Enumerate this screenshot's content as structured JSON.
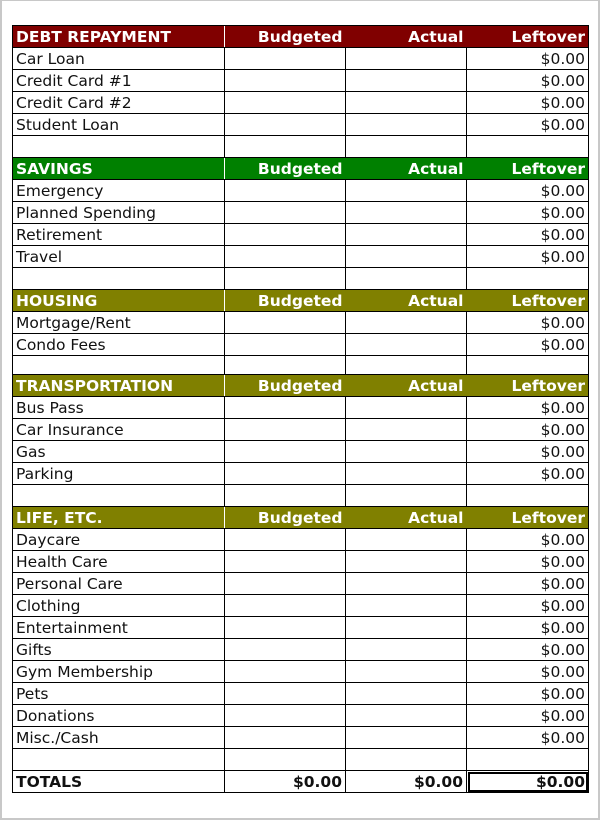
{
  "columns": [
    "Budgeted",
    "Actual",
    "Leftover"
  ],
  "colors": {
    "debt": "#800000",
    "savings": "#008000",
    "housing": "#808000",
    "transportation": "#808000",
    "life": "#808000"
  },
  "sections": [
    {
      "title": "DEBT REPAYMENT",
      "items": [
        {
          "label": "Car Loan",
          "budgeted": "",
          "actual": "",
          "leftover": "$0.00"
        },
        {
          "label": "Credit Card #1",
          "budgeted": "",
          "actual": "",
          "leftover": "$0.00"
        },
        {
          "label": "Credit Card #2",
          "budgeted": "",
          "actual": "",
          "leftover": "$0.00"
        },
        {
          "label": "Student Loan",
          "budgeted": "",
          "actual": "",
          "leftover": "$0.00"
        }
      ]
    },
    {
      "title": "SAVINGS",
      "items": [
        {
          "label": "Emergency",
          "budgeted": "",
          "actual": "",
          "leftover": "$0.00"
        },
        {
          "label": "Planned Spending",
          "budgeted": "",
          "actual": "",
          "leftover": "$0.00"
        },
        {
          "label": "Retirement",
          "budgeted": "",
          "actual": "",
          "leftover": "$0.00"
        },
        {
          "label": "Travel",
          "budgeted": "",
          "actual": "",
          "leftover": "$0.00"
        }
      ]
    },
    {
      "title": "HOUSING",
      "items": [
        {
          "label": "Mortgage/Rent",
          "budgeted": "",
          "actual": "",
          "leftover": "$0.00"
        },
        {
          "label": "Condo Fees",
          "budgeted": "",
          "actual": "",
          "leftover": "$0.00"
        }
      ]
    },
    {
      "title": "TRANSPORTATION",
      "items": [
        {
          "label": "Bus Pass",
          "budgeted": "",
          "actual": "",
          "leftover": "$0.00"
        },
        {
          "label": "Car Insurance",
          "budgeted": "",
          "actual": "",
          "leftover": "$0.00"
        },
        {
          "label": "Gas",
          "budgeted": "",
          "actual": "",
          "leftover": "$0.00"
        },
        {
          "label": "Parking",
          "budgeted": "",
          "actual": "",
          "leftover": "$0.00"
        }
      ]
    },
    {
      "title": "LIFE, ETC.",
      "items": [
        {
          "label": "Daycare",
          "budgeted": "",
          "actual": "",
          "leftover": "$0.00"
        },
        {
          "label": "Health Care",
          "budgeted": "",
          "actual": "",
          "leftover": "$0.00"
        },
        {
          "label": "Personal Care",
          "budgeted": "",
          "actual": "",
          "leftover": "$0.00"
        },
        {
          "label": "Clothing",
          "budgeted": "",
          "actual": "",
          "leftover": "$0.00"
        },
        {
          "label": "Entertainment",
          "budgeted": "",
          "actual": "",
          "leftover": "$0.00"
        },
        {
          "label": "Gifts",
          "budgeted": "",
          "actual": "",
          "leftover": "$0.00"
        },
        {
          "label": "Gym Membership",
          "budgeted": "",
          "actual": "",
          "leftover": "$0.00"
        },
        {
          "label": "Pets",
          "budgeted": "",
          "actual": "",
          "leftover": "$0.00"
        },
        {
          "label": "Donations",
          "budgeted": "",
          "actual": "",
          "leftover": "$0.00"
        },
        {
          "label": "Misc./Cash",
          "budgeted": "",
          "actual": "",
          "leftover": "$0.00"
        }
      ]
    }
  ],
  "totals": {
    "label": "TOTALS",
    "budgeted": "$0.00",
    "actual": "$0.00",
    "leftover": "$0.00"
  }
}
